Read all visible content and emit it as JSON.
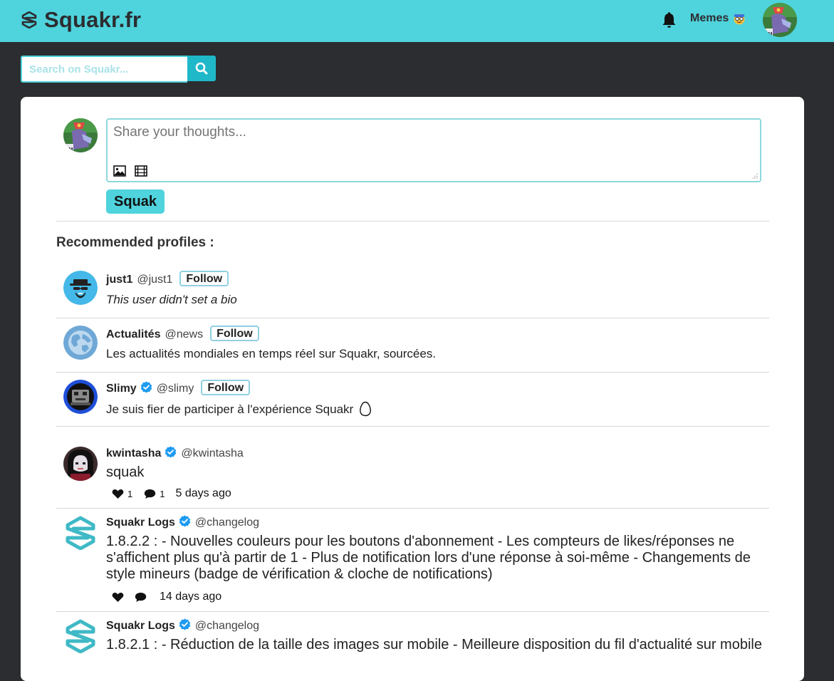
{
  "header": {
    "brand": "Squakr.fr",
    "memes_label": "Memes"
  },
  "search": {
    "placeholder": "Search on Squakr..."
  },
  "composer": {
    "placeholder": "Share your thoughts...",
    "submit_label": "Squak"
  },
  "recommended": {
    "title": "Recommended profiles :",
    "follow_label": "Follow",
    "profiles": [
      {
        "name": "just1",
        "handle": "@just1",
        "verified": false,
        "bio": "This user didn't set a bio",
        "avatar_icon": "spy-icon"
      },
      {
        "name": "Actualités",
        "handle": "@news",
        "verified": false,
        "bio": "Les actualités mondiales en temps réel sur Squakr, sourcées.",
        "avatar_icon": "globe-icon"
      },
      {
        "name": "Slimy",
        "handle": "@slimy",
        "verified": true,
        "bio": "Je suis fier de participer à l'expérience Squakr",
        "avatar_icon": "robot-icon"
      }
    ]
  },
  "feed": [
    {
      "name": "kwintasha",
      "handle": "@kwintasha",
      "verified": true,
      "text": "squak",
      "likes": "1",
      "replies": "1",
      "time": "5 days ago"
    },
    {
      "name": "Squakr Logs",
      "handle": "@changelog",
      "verified": true,
      "text": "1.8.2.2 : - Nouvelles couleurs pour les boutons d'abonnement - Les compteurs de likes/réponses ne s'affichent plus qu'à partir de 1 - Plus de notification lors d'une réponse à soi-même - Changements de style mineurs (badge de vérification & cloche de notifications)",
      "likes": "",
      "replies": "",
      "time": "14 days ago"
    },
    {
      "name": "Squakr Logs",
      "handle": "@changelog",
      "verified": true,
      "text": "1.8.2.1 : - Réduction de la taille des images sur mobile - Meilleure disposition du fil d'actualité sur mobile",
      "likes": "",
      "replies": "",
      "time": ""
    }
  ],
  "colors": {
    "accent": "#4fd3dc",
    "background": "#2b2d31",
    "verified": "#1d9bf0"
  }
}
